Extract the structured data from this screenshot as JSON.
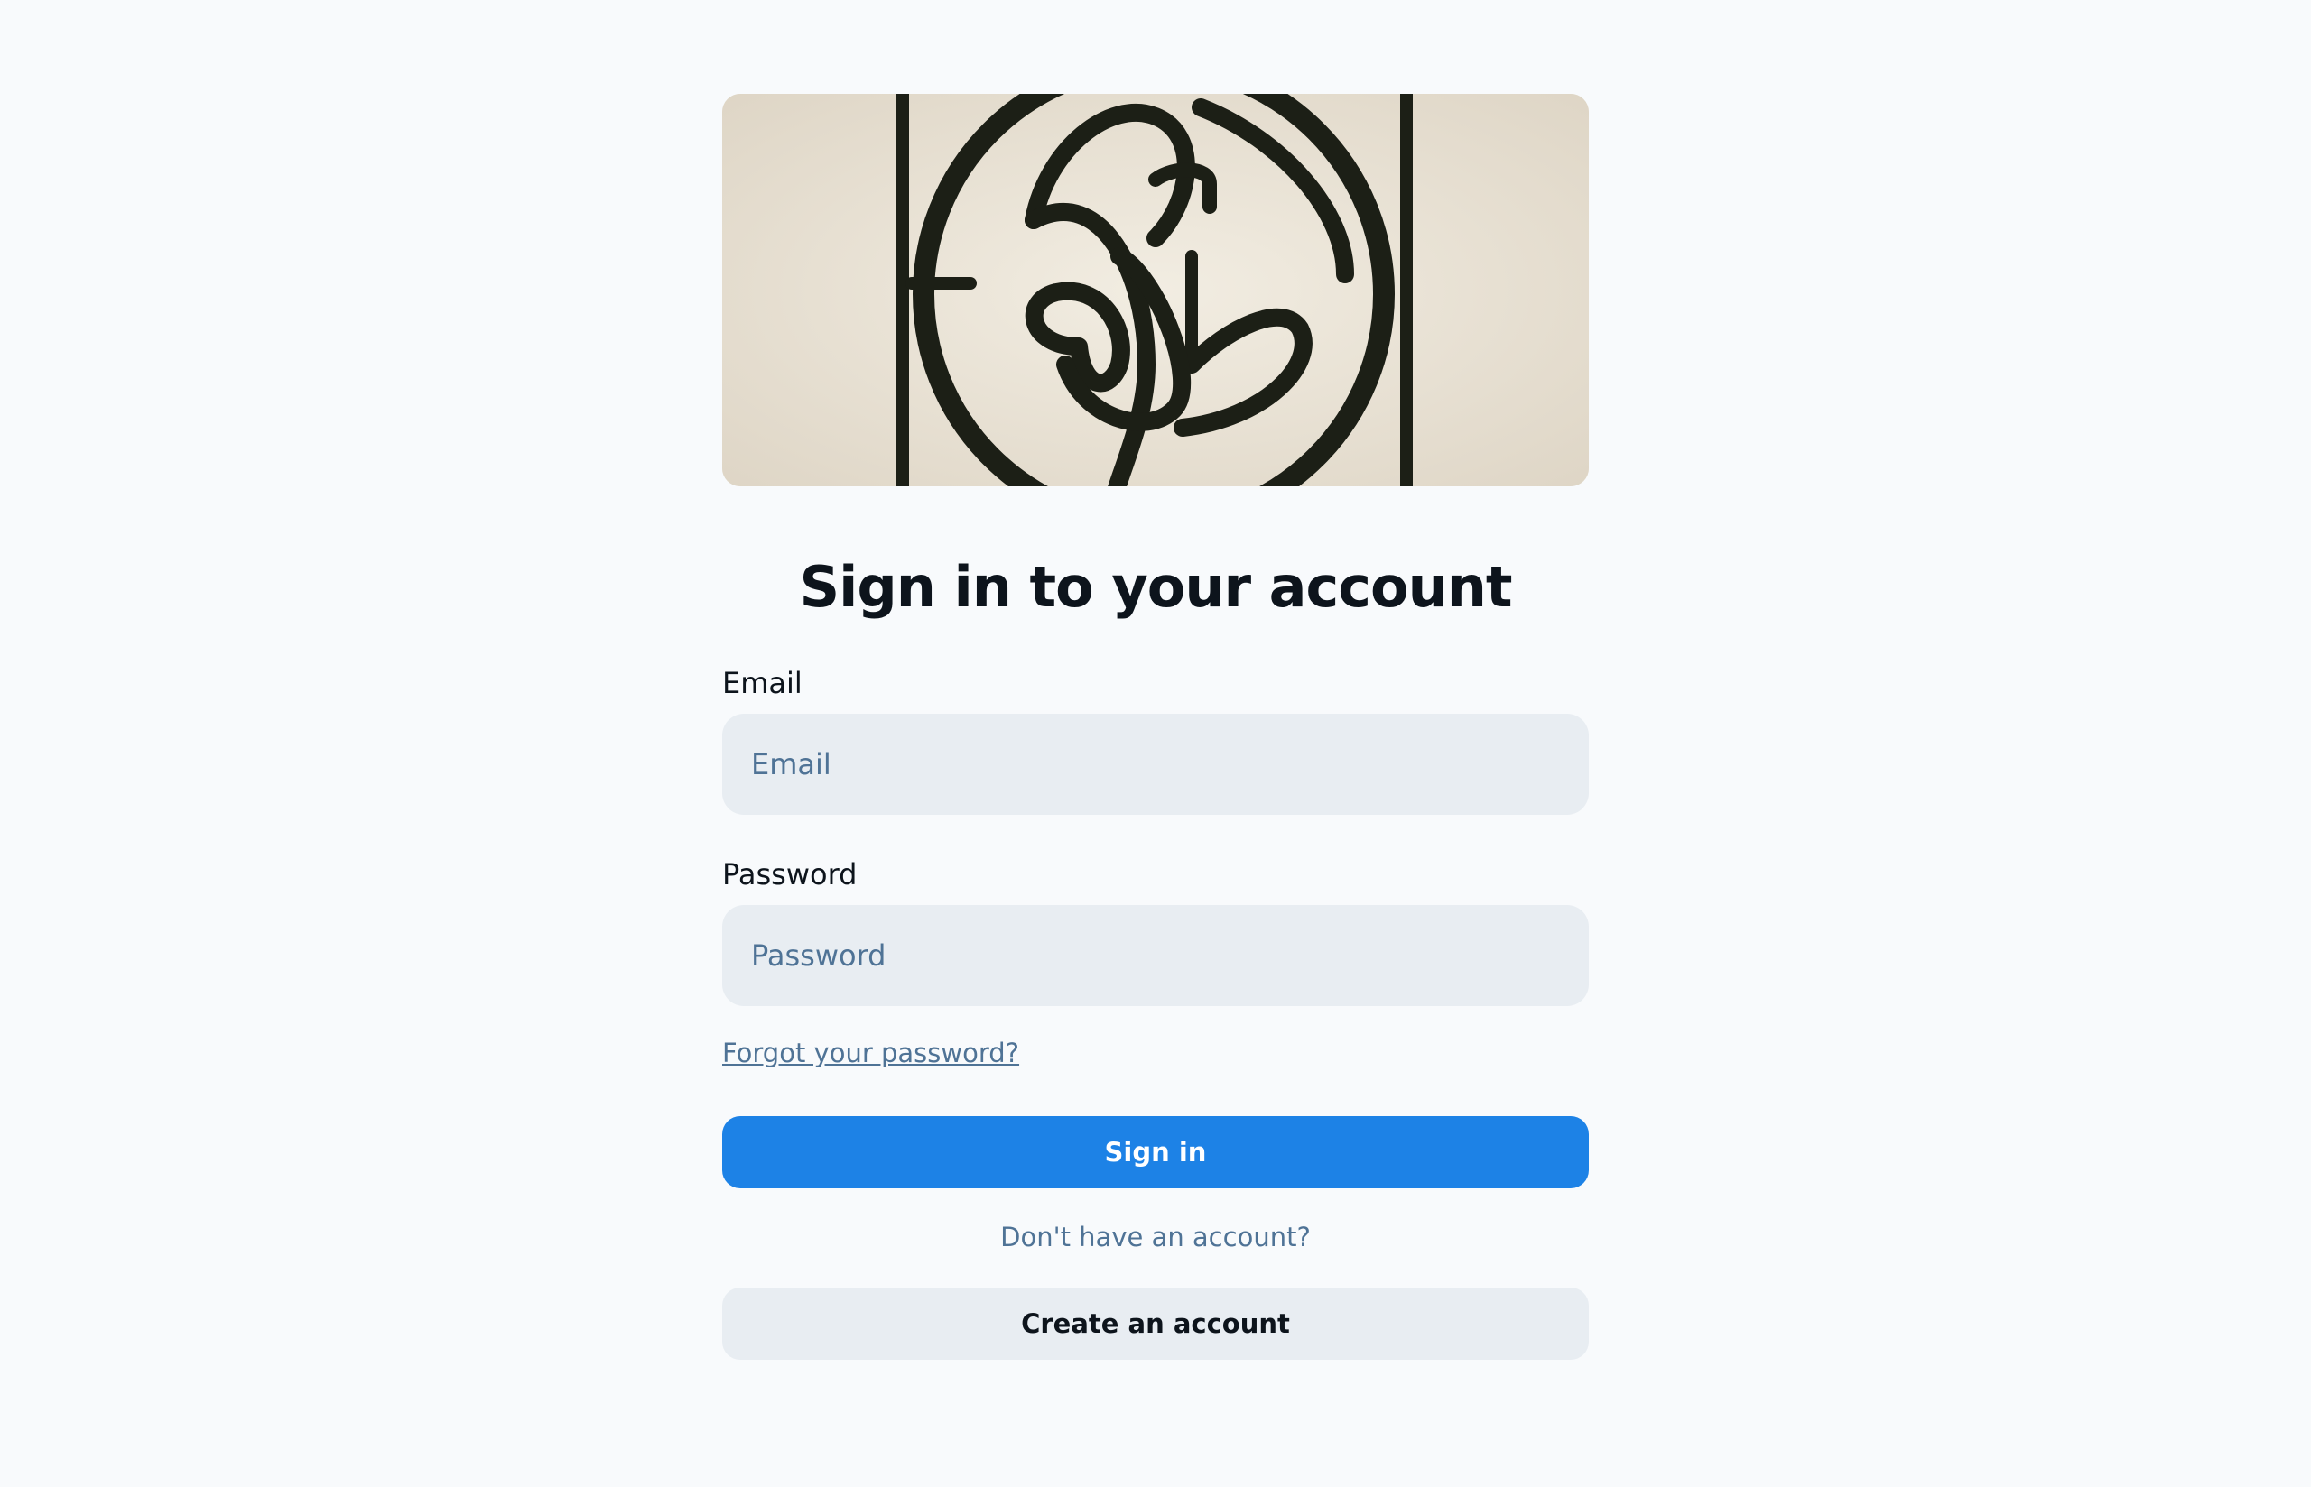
{
  "page": {
    "title": "Sign in to your account"
  },
  "hero": {
    "icon": "logo-emblem"
  },
  "form": {
    "email_label": "Email",
    "email_placeholder": "Email",
    "email_value": "",
    "password_label": "Password",
    "password_placeholder": "Password",
    "password_value": "",
    "forgot_link": "Forgot your password?",
    "sign_in_label": "Sign in",
    "signup_prompt": "Don't have an account?",
    "create_account_label": "Create an account"
  },
  "colors": {
    "background": "#f8fafc",
    "primary": "#1d82e6",
    "input_bg": "#e8edf2",
    "muted_text": "#4f7396",
    "text": "#0d141c"
  }
}
